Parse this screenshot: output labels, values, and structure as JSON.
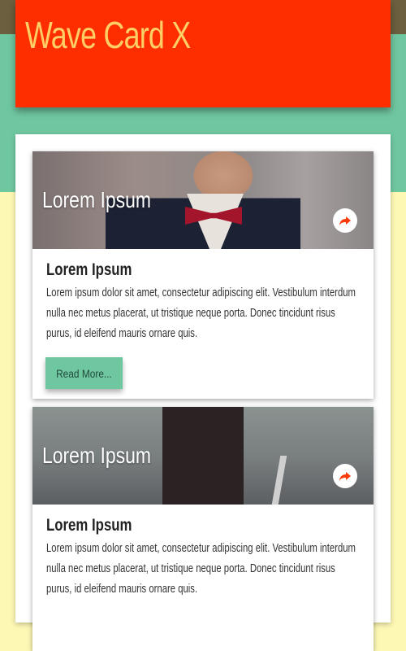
{
  "header": {
    "title": "Wave Card X"
  },
  "colors": {
    "header_bg": "#ff2e00",
    "title_color": "#ffcf66",
    "accent": "#6fc7a0",
    "page_bg": "#fdf8b4"
  },
  "cards": [
    {
      "image_title": "Lorem Ipsum",
      "title": "Lorem Ipsum",
      "text": "Lorem ipsum dolor sit amet, consectetur adipiscing elit. Vestibulum interdum nulla nec metus placerat, ut tristique neque porta. Donec tincidunt risus purus, id eleifend mauris ornare quis.",
      "button_label": "Read More...",
      "share_icon": "share-icon"
    },
    {
      "image_title": "Lorem Ipsum",
      "title": "Lorem Ipsum",
      "text": "Lorem ipsum dolor sit amet, consectetur adipiscing elit. Vestibulum interdum nulla nec metus placerat, ut tristique neque porta. Donec tincidunt risus purus, id eleifend mauris ornare quis.",
      "share_icon": "share-icon"
    }
  ]
}
